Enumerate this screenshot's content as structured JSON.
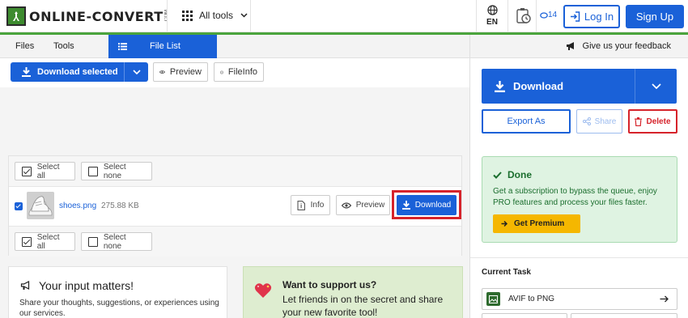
{
  "header": {
    "logo_text": "ONLINE-CONVERT",
    "logo_suffix": ".COM",
    "all_tools_label": "All tools",
    "language": "EN",
    "credits": "14",
    "login_label": "Log In",
    "signup_label": "Sign Up"
  },
  "tabs": {
    "files": "Files",
    "tools": "Tools",
    "file_list": "File List"
  },
  "feedback_link": "Give us your feedback",
  "toolbar": {
    "download_selected": "Download selected",
    "preview": "Preview",
    "fileinfo": "FileInfo"
  },
  "file_list": {
    "select_all": "Select all",
    "select_none": "Select none",
    "files": [
      {
        "name": "shoes.png",
        "size": "275.88 KB",
        "info_label": "Info",
        "preview_label": "Preview",
        "download_label": "Download"
      }
    ]
  },
  "feedback_card": {
    "title": "Your input matters!",
    "body": "Share your thoughts, suggestions, or experiences using our services."
  },
  "support_card": {
    "title": "Want to support us?",
    "body": "Let friends in on the secret and share your new favorite tool!"
  },
  "right_panel": {
    "download_label": "Download",
    "export_label": "Export As",
    "share_label": "Share",
    "delete_label": "Delete",
    "done_title": "Done",
    "done_body": "Get a subscription to bypass the queue, enjoy PRO features and process your files faster.",
    "premium_label": "Get Premium",
    "current_task_label": "Current Task",
    "task_name": "AVIF to PNG"
  },
  "colors": {
    "primary": "#1a61d8",
    "brand_green": "#4aa43c",
    "danger": "#d6232b",
    "success_bg": "#dff3e2",
    "premium": "#f5b700"
  }
}
